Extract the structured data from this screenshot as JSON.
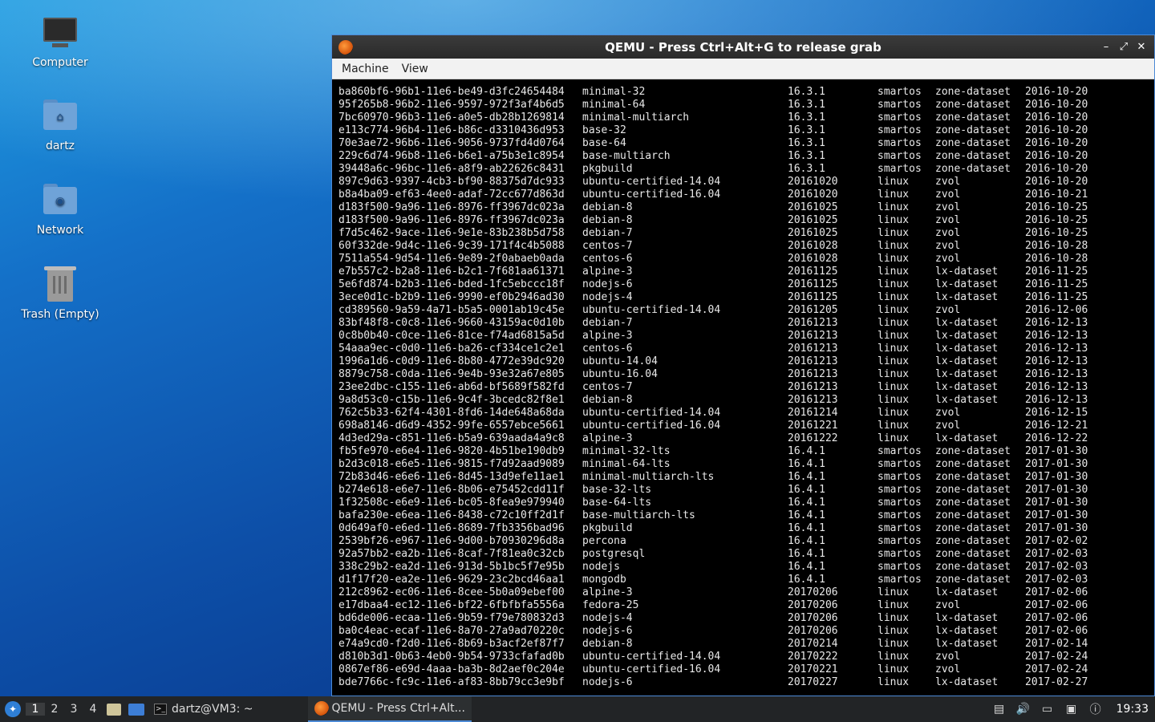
{
  "desktop": {
    "icons": [
      {
        "label": "Computer"
      },
      {
        "label": "dartz"
      },
      {
        "label": "Network"
      },
      {
        "label": "Trash (Empty)"
      }
    ]
  },
  "window": {
    "title": "QEMU - Press Ctrl+Alt+G to release grab",
    "menu": [
      "Machine",
      "View"
    ],
    "controls": {
      "minimize": "–",
      "restore": "⤢",
      "close": "✕"
    }
  },
  "console_rows": [
    [
      "ba860bf6-96b1-11e6-be49-d3fc24654484",
      "minimal-32",
      "16.3.1",
      "smartos",
      "zone-dataset",
      "2016-10-20"
    ],
    [
      "95f265b8-96b2-11e6-9597-972f3af4b6d5",
      "minimal-64",
      "16.3.1",
      "smartos",
      "zone-dataset",
      "2016-10-20"
    ],
    [
      "7bc60970-96b3-11e6-a0e5-db28b1269814",
      "minimal-multiarch",
      "16.3.1",
      "smartos",
      "zone-dataset",
      "2016-10-20"
    ],
    [
      "e113c774-96b4-11e6-b86c-d3310436d953",
      "base-32",
      "16.3.1",
      "smartos",
      "zone-dataset",
      "2016-10-20"
    ],
    [
      "70e3ae72-96b6-11e6-9056-9737fd4d0764",
      "base-64",
      "16.3.1",
      "smartos",
      "zone-dataset",
      "2016-10-20"
    ],
    [
      "229c6d74-96b8-11e6-b6e1-a75b3e1c8954",
      "base-multiarch",
      "16.3.1",
      "smartos",
      "zone-dataset",
      "2016-10-20"
    ],
    [
      "39448a6c-96bc-11e6-a8f9-ab22626c8431",
      "pkgbuild",
      "16.3.1",
      "smartos",
      "zone-dataset",
      "2016-10-20"
    ],
    [
      "897c9d63-9397-4cb3-bf90-88375d7dc933",
      "ubuntu-certified-14.04",
      "20161020",
      "linux",
      "zvol",
      "2016-10-20"
    ],
    [
      "b8a4ba09-ef63-4ee0-adaf-72cc677d863d",
      "ubuntu-certified-16.04",
      "20161020",
      "linux",
      "zvol",
      "2016-10-21"
    ],
    [
      "d183f500-9a96-11e6-8976-ff3967dc023a",
      "debian-8",
      "20161025",
      "linux",
      "zvol",
      "2016-10-25"
    ],
    [
      "d183f500-9a96-11e6-8976-ff3967dc023a",
      "debian-8",
      "20161025",
      "linux",
      "zvol",
      "2016-10-25"
    ],
    [
      "f7d5c462-9ace-11e6-9e1e-83b238b5d758",
      "debian-7",
      "20161025",
      "linux",
      "zvol",
      "2016-10-25"
    ],
    [
      "60f332de-9d4c-11e6-9c39-171f4c4b5088",
      "centos-7",
      "20161028",
      "linux",
      "zvol",
      "2016-10-28"
    ],
    [
      "7511a554-9d54-11e6-9e89-2f0abaeb0ada",
      "centos-6",
      "20161028",
      "linux",
      "zvol",
      "2016-10-28"
    ],
    [
      "e7b557c2-b2a8-11e6-b2c1-7f681aa61371",
      "alpine-3",
      "20161125",
      "linux",
      "lx-dataset",
      "2016-11-25"
    ],
    [
      "5e6fd874-b2b3-11e6-bded-1fc5ebccc18f",
      "nodejs-6",
      "20161125",
      "linux",
      "lx-dataset",
      "2016-11-25"
    ],
    [
      "3ece0d1c-b2b9-11e6-9990-ef0b2946ad30",
      "nodejs-4",
      "20161125",
      "linux",
      "lx-dataset",
      "2016-11-25"
    ],
    [
      "cd389560-9a59-4a71-b5a5-0001ab19c45e",
      "ubuntu-certified-14.04",
      "20161205",
      "linux",
      "zvol",
      "2016-12-06"
    ],
    [
      "83bf48f8-c0c8-11e6-9660-43159ac0d10b",
      "debian-7",
      "20161213",
      "linux",
      "lx-dataset",
      "2016-12-13"
    ],
    [
      "0c8b0b40-c0ce-11e6-81ce-f74ad6815a5d",
      "alpine-3",
      "20161213",
      "linux",
      "lx-dataset",
      "2016-12-13"
    ],
    [
      "54aaa9ec-c0d0-11e6-ba26-cf334ce1c2e1",
      "centos-6",
      "20161213",
      "linux",
      "lx-dataset",
      "2016-12-13"
    ],
    [
      "1996a1d6-c0d9-11e6-8b80-4772e39dc920",
      "ubuntu-14.04",
      "20161213",
      "linux",
      "lx-dataset",
      "2016-12-13"
    ],
    [
      "8879c758-c0da-11e6-9e4b-93e32a67e805",
      "ubuntu-16.04",
      "20161213",
      "linux",
      "lx-dataset",
      "2016-12-13"
    ],
    [
      "23ee2dbc-c155-11e6-ab6d-bf5689f582fd",
      "centos-7",
      "20161213",
      "linux",
      "lx-dataset",
      "2016-12-13"
    ],
    [
      "9a8d53c0-c15b-11e6-9c4f-3bcedc82f8e1",
      "debian-8",
      "20161213",
      "linux",
      "lx-dataset",
      "2016-12-13"
    ],
    [
      "762c5b33-62f4-4301-8fd6-14de648a68da",
      "ubuntu-certified-14.04",
      "20161214",
      "linux",
      "zvol",
      "2016-12-15"
    ],
    [
      "698a8146-d6d9-4352-99fe-6557ebce5661",
      "ubuntu-certified-16.04",
      "20161221",
      "linux",
      "zvol",
      "2016-12-21"
    ],
    [
      "4d3ed29a-c851-11e6-b5a9-639aada4a9c8",
      "alpine-3",
      "20161222",
      "linux",
      "lx-dataset",
      "2016-12-22"
    ],
    [
      "fb5fe970-e6e4-11e6-9820-4b51be190db9",
      "minimal-32-lts",
      "16.4.1",
      "smartos",
      "zone-dataset",
      "2017-01-30"
    ],
    [
      "b2d3c018-e6e5-11e6-9815-f7d92aad9089",
      "minimal-64-lts",
      "16.4.1",
      "smartos",
      "zone-dataset",
      "2017-01-30"
    ],
    [
      "72b83d46-e6e6-11e6-8d45-13d9efe11ae1",
      "minimal-multiarch-lts",
      "16.4.1",
      "smartos",
      "zone-dataset",
      "2017-01-30"
    ],
    [
      "b274e618-e6e7-11e6-8b06-e75452cdd11f",
      "base-32-lts",
      "16.4.1",
      "smartos",
      "zone-dataset",
      "2017-01-30"
    ],
    [
      "1f32508c-e6e9-11e6-bc05-8fea9e979940",
      "base-64-lts",
      "16.4.1",
      "smartos",
      "zone-dataset",
      "2017-01-30"
    ],
    [
      "bafa230e-e6ea-11e6-8438-c72c10ff2d1f",
      "base-multiarch-lts",
      "16.4.1",
      "smartos",
      "zone-dataset",
      "2017-01-30"
    ],
    [
      "0d649af0-e6ed-11e6-8689-7fb3356bad96",
      "pkgbuild",
      "16.4.1",
      "smartos",
      "zone-dataset",
      "2017-01-30"
    ],
    [
      "2539bf26-e967-11e6-9d00-b70930296d8a",
      "percona",
      "16.4.1",
      "smartos",
      "zone-dataset",
      "2017-02-02"
    ],
    [
      "92a57bb2-ea2b-11e6-8caf-7f81ea0c32cb",
      "postgresql",
      "16.4.1",
      "smartos",
      "zone-dataset",
      "2017-02-03"
    ],
    [
      "338c29b2-ea2d-11e6-913d-5b1bc5f7e95b",
      "nodejs",
      "16.4.1",
      "smartos",
      "zone-dataset",
      "2017-02-03"
    ],
    [
      "d1f17f20-ea2e-11e6-9629-23c2bcd46aa1",
      "mongodb",
      "16.4.1",
      "smartos",
      "zone-dataset",
      "2017-02-03"
    ],
    [
      "212c8962-ec06-11e6-8cee-5b0a09ebef00",
      "alpine-3",
      "20170206",
      "linux",
      "lx-dataset",
      "2017-02-06"
    ],
    [
      "e17dbaa4-ec12-11e6-bf22-6fbfbfa5556a",
      "fedora-25",
      "20170206",
      "linux",
      "zvol",
      "2017-02-06"
    ],
    [
      "bd6de006-ecaa-11e6-9b59-f79e780832d3",
      "nodejs-4",
      "20170206",
      "linux",
      "lx-dataset",
      "2017-02-06"
    ],
    [
      "ba0c4eac-ecaf-11e6-8a70-27a9ad70220c",
      "nodejs-6",
      "20170206",
      "linux",
      "lx-dataset",
      "2017-02-06"
    ],
    [
      "e74a9cd0-f2d0-11e6-8b69-b3acf2ef87f7",
      "debian-8",
      "20170214",
      "linux",
      "lx-dataset",
      "2017-02-14"
    ],
    [
      "d810b3d1-0b63-4eb0-9b54-9733cfafad0b",
      "ubuntu-certified-14.04",
      "20170222",
      "linux",
      "zvol",
      "2017-02-24"
    ],
    [
      "0867ef86-e69d-4aaa-ba3b-8d2aef0c204e",
      "ubuntu-certified-16.04",
      "20170221",
      "linux",
      "zvol",
      "2017-02-24"
    ],
    [
      "bde7766c-fc9c-11e6-af83-8bb79cc3e9bf",
      "nodejs-6",
      "20170227",
      "linux",
      "lx-dataset",
      "2017-02-27"
    ]
  ],
  "taskbar": {
    "workspaces": [
      "1",
      "2",
      "3",
      "4"
    ],
    "active_workspace": 0,
    "tasks": [
      {
        "label": "dartz@VM3: ~"
      },
      {
        "label": "QEMU - Press Ctrl+Alt..."
      }
    ],
    "clock": "19:33"
  }
}
